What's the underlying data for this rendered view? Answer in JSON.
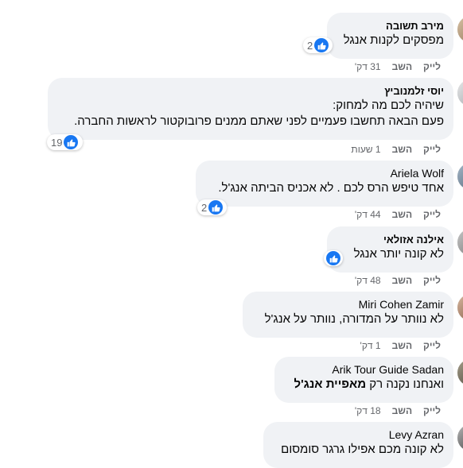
{
  "actions": {
    "like": "לייק",
    "reply": "השב"
  },
  "comments": [
    {
      "author": "מירב תשובה",
      "lines": [
        "מפסקים לקנות אנגל"
      ],
      "reactions": "2",
      "time": "31 דק'"
    },
    {
      "author": "יוסי זלמנוביץ",
      "lines": [
        "שיהיה לכם מה למחוק:",
        "פעם הבאה תחשבו פעמיים לפני שאתם ממנים פרובוקטור לראשות החברה."
      ],
      "reactions": "19",
      "time": "1 שעות"
    },
    {
      "author": "Ariela Wolf",
      "lines": [
        "אחד טיפש הרס לכם . לא אכניס הביתה אנג'ל."
      ],
      "reactions": "2",
      "time": "44 דק'"
    },
    {
      "author": "אילנה אזולאי",
      "lines": [
        "לא קונה יותר אנגל"
      ],
      "reactions": "",
      "time": "48 דק'"
    },
    {
      "author": "Miri Cohen Zamir",
      "lines": [
        "לא נוותר על המדורה, נוותר על אנג'ל"
      ],
      "reactions": "",
      "time": "1 דק'"
    },
    {
      "author": "Arik Tour Guide Sadan",
      "lines_prefix": "ואנחנו נקנה רק ",
      "lines_bold": "מאפיית אנג'ל",
      "time": "18 דק'"
    },
    {
      "author": "Levy Azran",
      "lines": [
        "לא קונה מכם אפילו גרגר סומסום"
      ]
    }
  ],
  "colors": {
    "bubble": "#f0f2f5",
    "like_blue": "#1877f2",
    "meta_gray": "#65676b"
  }
}
